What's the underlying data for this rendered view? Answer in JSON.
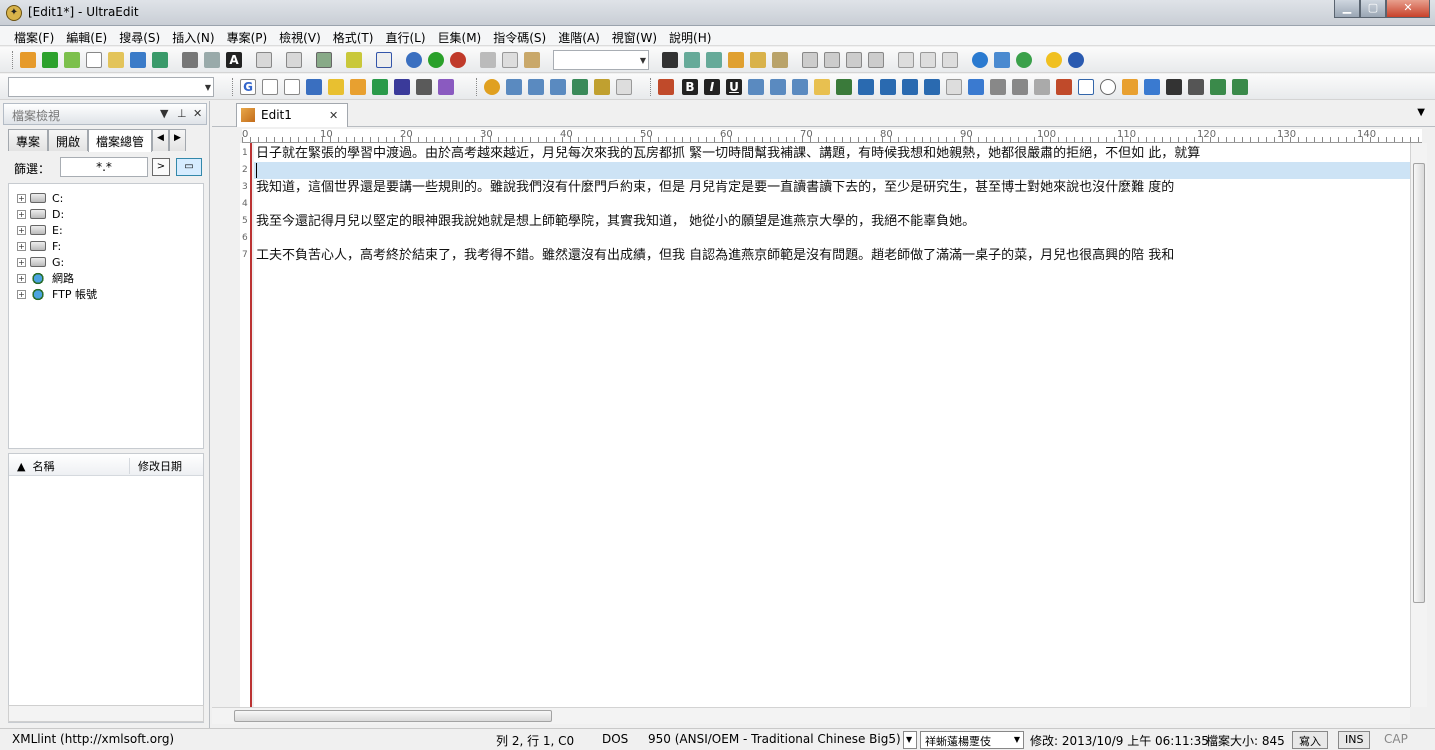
{
  "window": {
    "title": "[Edit1*] - UltraEdit"
  },
  "menu": [
    "檔案(F)",
    "編輯(E)",
    "搜尋(S)",
    "插入(N)",
    "專案(P)",
    "檢視(V)",
    "格式(T)",
    "直行(L)",
    "巨集(M)",
    "指令碼(S)",
    "進階(A)",
    "視窗(W)",
    "說明(H)"
  ],
  "left_panel": {
    "title": "檔案檢視",
    "tabs": [
      "專案",
      "開啟",
      "檔案總管"
    ],
    "filter_label": "篩選：",
    "filter_value": "*.*",
    "tree": [
      "C:",
      "D:",
      "E:",
      "F:",
      "G:",
      "網路",
      "FTP 帳號"
    ],
    "list_columns": [
      "名稱",
      "修改日期"
    ]
  },
  "editor": {
    "tab_label": "Edit1",
    "ruler": [
      "0",
      "10",
      "20",
      "30",
      "40",
      "50",
      "60",
      "70",
      "80",
      "90",
      "100",
      "110",
      "120",
      "130",
      "140"
    ],
    "line_numbers": [
      "1",
      "2",
      "3",
      "4",
      "5",
      "6",
      "7"
    ],
    "lines": [
      "日子就在緊張的學習中渡過。由於高考越來越近，月兒每次來我的瓦房都抓  緊一切時間幫我補課、講題，有時候我想和她親熱，她都很嚴肅的拒絕，不但如  此，就算",
      "",
      "      我知道，這個世界還是要講一些規則的。雖說我們沒有什麼門戶約束，但是  月兒肯定是要一直讀書讀下去的，至少是研究生，甚至博士對她來說也沒什麼難  度的",
      "",
      "      我至今還記得月兒以堅定的眼神跟我說她就是想上師範學院，其實我知道，  她從小的願望是進燕京大學的，我絕不能辜負她。",
      "",
      "      工夫不負苦心人，高考終於結束了，我考得不錯。雖然還沒有出成績，但我  自認為進燕京師範是沒有問題。趙老師做了滿滿一桌子的菜，月兒也很高興的陪  我和"
    ]
  },
  "status": {
    "left": "XMLlint (http://xmlsoft.org)",
    "position": "列 2, 行 1, C0",
    "format": "DOS",
    "encoding": "950  (ANSI/OEM - Traditional Chinese Big5)",
    "font_combo": "祥蜥薳楊覂伎",
    "modified": "修改: 2013/10/9 上午 06:11:35",
    "size": "檔案大小: 845",
    "write": "寫入",
    "ins": "INS",
    "cap": "CAP"
  }
}
